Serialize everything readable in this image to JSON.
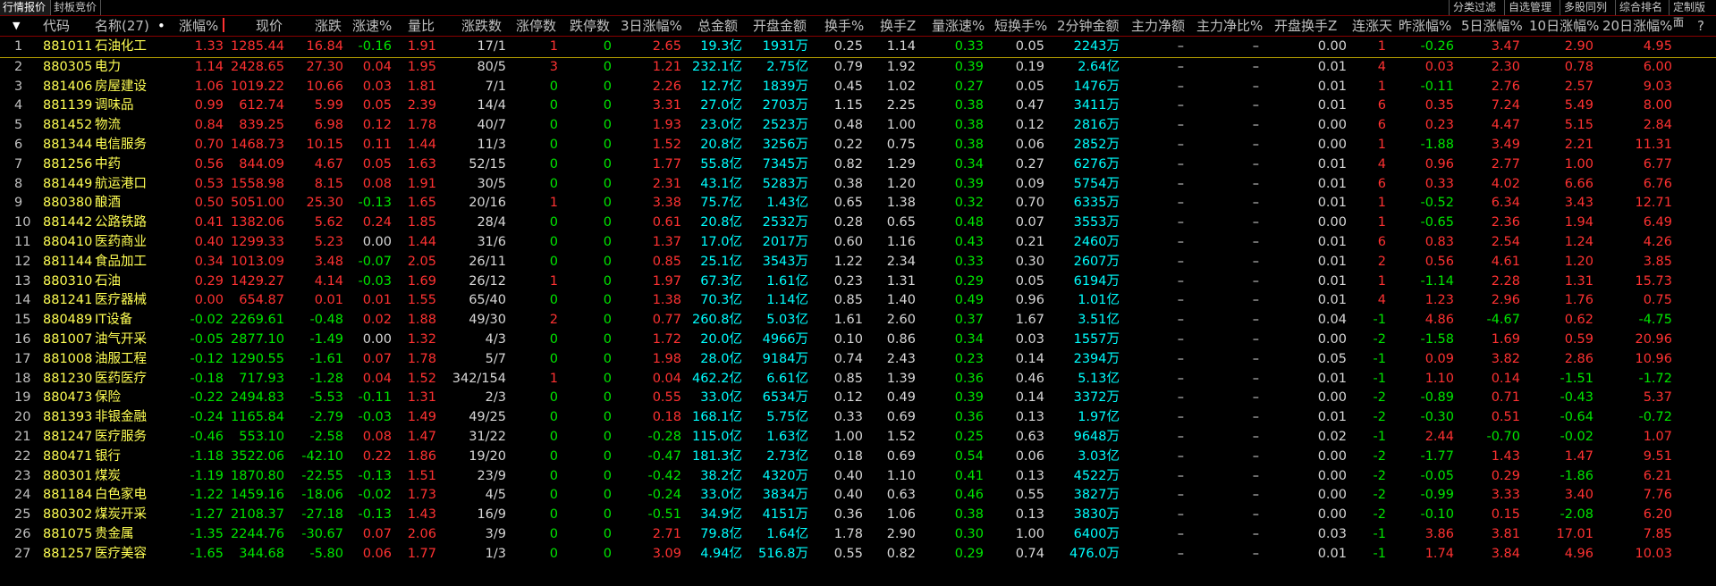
{
  "tabs": {
    "quotes": "行情报价",
    "seal": "封板竞价"
  },
  "right_tabs": {
    "filter": "分类过滤",
    "custom": "自选管理",
    "multi": "多股同列",
    "rank": "综合排名",
    "layout": "定制版面"
  },
  "sort_glyph": "▼",
  "name_suffix": "•",
  "question_mark": "?",
  "header": {
    "code": "代码",
    "name": "名称(27)",
    "pct": "涨幅%",
    "price": "现价",
    "change": "涨跌",
    "speed": "涨速%",
    "ratio": "量比",
    "updown": "涨跌数",
    "limitup": "涨停数",
    "limitdown": "跌停数",
    "pct3d": "3日涨幅%",
    "amount": "总金额",
    "openamt": "开盘金额",
    "turnover": "换手%",
    "turnoverz": "换手Z",
    "volspeed": "量涨速%",
    "shortturn": "短换手%",
    "amt2m": "2分钟金额",
    "mainnet": "主力净额",
    "mainpct": "主力净比%",
    "openturnz": "开盘换手Z",
    "streak": "连涨天",
    "yestpct": "昨涨幅%",
    "pct5d": "5日涨幅%",
    "pct10d": "10日涨幅%",
    "pct20d": "20日涨幅%"
  },
  "rows": [
    {
      "idx": "1",
      "code": "881011",
      "name": "石油化工",
      "pct": "1.33",
      "price": "1285.44",
      "change": "16.84",
      "speed": "-0.16",
      "ratio": "1.91",
      "updown": "17/1",
      "limitup": "1",
      "limitdown": "0",
      "pct3d": "2.65",
      "amount": "19.3亿",
      "openamt": "1931万",
      "turnover": "0.25",
      "turnoverz": "1.14",
      "volspeed": "0.33",
      "shortturn": "0.05",
      "amt2m": "2243万",
      "mainnet": "–",
      "mainpct": "–",
      "openturnz": "0.00",
      "streak": "1",
      "yestpct": "-0.26",
      "pct5d": "3.47",
      "pct10d": "2.90",
      "pct20d": "4.95"
    },
    {
      "idx": "2",
      "code": "880305",
      "name": "电力",
      "pct": "1.14",
      "price": "2428.65",
      "change": "27.30",
      "speed": "0.04",
      "ratio": "1.95",
      "updown": "80/5",
      "limitup": "3",
      "limitdown": "0",
      "pct3d": "1.21",
      "amount": "232.1亿",
      "openamt": "2.75亿",
      "turnover": "0.79",
      "turnoverz": "1.92",
      "volspeed": "0.39",
      "shortturn": "0.19",
      "amt2m": "2.64亿",
      "mainnet": "–",
      "mainpct": "–",
      "openturnz": "0.01",
      "streak": "4",
      "yestpct": "0.03",
      "pct5d": "2.30",
      "pct10d": "0.78",
      "pct20d": "6.00"
    },
    {
      "idx": "3",
      "code": "881406",
      "name": "房屋建设",
      "pct": "1.06",
      "price": "1019.22",
      "change": "10.66",
      "speed": "0.03",
      "ratio": "1.81",
      "updown": "7/1",
      "limitup": "0",
      "limitdown": "0",
      "pct3d": "2.26",
      "amount": "12.7亿",
      "openamt": "1839万",
      "turnover": "0.45",
      "turnoverz": "1.02",
      "volspeed": "0.27",
      "shortturn": "0.05",
      "amt2m": "1476万",
      "mainnet": "–",
      "mainpct": "–",
      "openturnz": "0.01",
      "streak": "1",
      "yestpct": "-0.11",
      "pct5d": "2.76",
      "pct10d": "2.57",
      "pct20d": "9.03"
    },
    {
      "idx": "4",
      "code": "881139",
      "name": "调味品",
      "pct": "0.99",
      "price": "612.74",
      "change": "5.99",
      "speed": "0.05",
      "ratio": "2.39",
      "updown": "14/4",
      "limitup": "0",
      "limitdown": "0",
      "pct3d": "3.31",
      "amount": "27.0亿",
      "openamt": "2703万",
      "turnover": "1.15",
      "turnoverz": "2.25",
      "volspeed": "0.38",
      "shortturn": "0.47",
      "amt2m": "3411万",
      "mainnet": "–",
      "mainpct": "–",
      "openturnz": "0.01",
      "streak": "6",
      "yestpct": "0.35",
      "pct5d": "7.24",
      "pct10d": "5.49",
      "pct20d": "8.00"
    },
    {
      "idx": "5",
      "code": "881452",
      "name": "物流",
      "pct": "0.84",
      "price": "839.25",
      "change": "6.98",
      "speed": "0.12",
      "ratio": "1.78",
      "updown": "40/7",
      "limitup": "0",
      "limitdown": "0",
      "pct3d": "1.93",
      "amount": "23.0亿",
      "openamt": "2523万",
      "turnover": "0.48",
      "turnoverz": "1.00",
      "volspeed": "0.38",
      "shortturn": "0.12",
      "amt2m": "2816万",
      "mainnet": "–",
      "mainpct": "–",
      "openturnz": "0.00",
      "streak": "6",
      "yestpct": "0.23",
      "pct5d": "4.47",
      "pct10d": "5.15",
      "pct20d": "2.84"
    },
    {
      "idx": "6",
      "code": "881344",
      "name": "电信服务",
      "pct": "0.70",
      "price": "1468.73",
      "change": "10.15",
      "speed": "0.11",
      "ratio": "1.44",
      "updown": "11/3",
      "limitup": "0",
      "limitdown": "0",
      "pct3d": "1.52",
      "amount": "20.8亿",
      "openamt": "3256万",
      "turnover": "0.22",
      "turnoverz": "0.75",
      "volspeed": "0.38",
      "shortturn": "0.06",
      "amt2m": "2852万",
      "mainnet": "–",
      "mainpct": "–",
      "openturnz": "0.00",
      "streak": "1",
      "yestpct": "-1.88",
      "pct5d": "3.49",
      "pct10d": "2.21",
      "pct20d": "11.31"
    },
    {
      "idx": "7",
      "code": "881256",
      "name": "中药",
      "pct": "0.56",
      "price": "844.09",
      "change": "4.67",
      "speed": "0.05",
      "ratio": "1.63",
      "updown": "52/15",
      "limitup": "0",
      "limitdown": "0",
      "pct3d": "1.77",
      "amount": "55.8亿",
      "openamt": "7345万",
      "turnover": "0.82",
      "turnoverz": "1.29",
      "volspeed": "0.34",
      "shortturn": "0.27",
      "amt2m": "6276万",
      "mainnet": "–",
      "mainpct": "–",
      "openturnz": "0.01",
      "streak": "4",
      "yestpct": "0.96",
      "pct5d": "2.77",
      "pct10d": "1.00",
      "pct20d": "6.77"
    },
    {
      "idx": "8",
      "code": "881449",
      "name": "航运港口",
      "pct": "0.53",
      "price": "1558.98",
      "change": "8.15",
      "speed": "0.08",
      "ratio": "1.91",
      "updown": "30/5",
      "limitup": "0",
      "limitdown": "0",
      "pct3d": "2.31",
      "amount": "43.1亿",
      "openamt": "5283万",
      "turnover": "0.38",
      "turnoverz": "1.20",
      "volspeed": "0.39",
      "shortturn": "0.09",
      "amt2m": "5754万",
      "mainnet": "–",
      "mainpct": "–",
      "openturnz": "0.01",
      "streak": "6",
      "yestpct": "0.33",
      "pct5d": "4.02",
      "pct10d": "6.66",
      "pct20d": "6.76"
    },
    {
      "idx": "9",
      "code": "880380",
      "name": "酿酒",
      "pct": "0.50",
      "price": "5051.00",
      "change": "25.30",
      "speed": "-0.13",
      "ratio": "1.65",
      "updown": "20/16",
      "limitup": "1",
      "limitdown": "0",
      "pct3d": "3.38",
      "amount": "75.7亿",
      "openamt": "1.43亿",
      "turnover": "0.65",
      "turnoverz": "1.38",
      "volspeed": "0.32",
      "shortturn": "0.70",
      "amt2m": "6335万",
      "mainnet": "–",
      "mainpct": "–",
      "openturnz": "0.01",
      "streak": "1",
      "yestpct": "-0.52",
      "pct5d": "6.34",
      "pct10d": "3.43",
      "pct20d": "12.71"
    },
    {
      "idx": "10",
      "code": "881442",
      "name": "公路铁路",
      "pct": "0.41",
      "price": "1382.06",
      "change": "5.62",
      "speed": "0.24",
      "ratio": "1.85",
      "updown": "28/4",
      "limitup": "0",
      "limitdown": "0",
      "pct3d": "0.61",
      "amount": "20.8亿",
      "openamt": "2532万",
      "turnover": "0.28",
      "turnoverz": "0.65",
      "volspeed": "0.48",
      "shortturn": "0.07",
      "amt2m": "3553万",
      "mainnet": "–",
      "mainpct": "–",
      "openturnz": "0.00",
      "streak": "1",
      "yestpct": "-0.65",
      "pct5d": "2.36",
      "pct10d": "1.94",
      "pct20d": "6.49"
    },
    {
      "idx": "11",
      "code": "880410",
      "name": "医药商业",
      "pct": "0.40",
      "price": "1299.33",
      "change": "5.23",
      "speed": "0.00",
      "ratio": "1.44",
      "updown": "31/6",
      "limitup": "0",
      "limitdown": "0",
      "pct3d": "1.37",
      "amount": "17.0亿",
      "openamt": "2017万",
      "turnover": "0.60",
      "turnoverz": "1.16",
      "volspeed": "0.43",
      "shortturn": "0.21",
      "amt2m": "2460万",
      "mainnet": "–",
      "mainpct": "–",
      "openturnz": "0.01",
      "streak": "6",
      "yestpct": "0.83",
      "pct5d": "2.54",
      "pct10d": "1.24",
      "pct20d": "4.26"
    },
    {
      "idx": "12",
      "code": "881144",
      "name": "食品加工",
      "pct": "0.34",
      "price": "1013.09",
      "change": "3.48",
      "speed": "-0.07",
      "ratio": "2.05",
      "updown": "26/11",
      "limitup": "0",
      "limitdown": "0",
      "pct3d": "0.85",
      "amount": "25.1亿",
      "openamt": "3543万",
      "turnover": "1.22",
      "turnoverz": "2.34",
      "volspeed": "0.33",
      "shortturn": "0.30",
      "amt2m": "2607万",
      "mainnet": "–",
      "mainpct": "–",
      "openturnz": "0.01",
      "streak": "2",
      "yestpct": "0.56",
      "pct5d": "4.61",
      "pct10d": "1.20",
      "pct20d": "3.85"
    },
    {
      "idx": "13",
      "code": "880310",
      "name": "石油",
      "pct": "0.29",
      "price": "1429.27",
      "change": "4.14",
      "speed": "-0.03",
      "ratio": "1.69",
      "updown": "26/12",
      "limitup": "1",
      "limitdown": "0",
      "pct3d": "1.97",
      "amount": "67.3亿",
      "openamt": "1.61亿",
      "turnover": "0.23",
      "turnoverz": "1.31",
      "volspeed": "0.29",
      "shortturn": "0.05",
      "amt2m": "6194万",
      "mainnet": "–",
      "mainpct": "–",
      "openturnz": "0.01",
      "streak": "1",
      "yestpct": "-1.14",
      "pct5d": "2.28",
      "pct10d": "1.31",
      "pct20d": "15.73"
    },
    {
      "idx": "14",
      "code": "881241",
      "name": "医疗器械",
      "pct": "0.00",
      "price": "654.87",
      "change": "0.01",
      "speed": "0.01",
      "ratio": "1.55",
      "updown": "65/40",
      "limitup": "0",
      "limitdown": "0",
      "pct3d": "1.38",
      "amount": "70.3亿",
      "openamt": "1.14亿",
      "turnover": "0.85",
      "turnoverz": "1.40",
      "volspeed": "0.49",
      "shortturn": "0.96",
      "amt2m": "1.01亿",
      "mainnet": "–",
      "mainpct": "–",
      "openturnz": "0.01",
      "streak": "4",
      "yestpct": "1.23",
      "pct5d": "2.96",
      "pct10d": "1.76",
      "pct20d": "0.75"
    },
    {
      "idx": "15",
      "code": "880489",
      "name": "IT设备",
      "pct": "-0.02",
      "price": "2269.61",
      "change": "-0.48",
      "speed": "0.02",
      "ratio": "1.88",
      "updown": "49/30",
      "limitup": "2",
      "limitdown": "0",
      "pct3d": "0.77",
      "amount": "260.8亿",
      "openamt": "5.03亿",
      "turnover": "1.61",
      "turnoverz": "2.60",
      "volspeed": "0.37",
      "shortturn": "1.67",
      "amt2m": "3.51亿",
      "mainnet": "–",
      "mainpct": "–",
      "openturnz": "0.04",
      "streak": "-1",
      "yestpct": "4.86",
      "pct5d": "-4.67",
      "pct10d": "0.62",
      "pct20d": "-4.75"
    },
    {
      "idx": "16",
      "code": "881007",
      "name": "油气开采",
      "pct": "-0.05",
      "price": "2877.10",
      "change": "-1.49",
      "speed": "0.00",
      "ratio": "1.32",
      "updown": "4/3",
      "limitup": "0",
      "limitdown": "0",
      "pct3d": "1.72",
      "amount": "20.0亿",
      "openamt": "4966万",
      "turnover": "0.10",
      "turnoverz": "0.86",
      "volspeed": "0.34",
      "shortturn": "0.03",
      "amt2m": "1557万",
      "mainnet": "–",
      "mainpct": "–",
      "openturnz": "0.00",
      "streak": "-2",
      "yestpct": "-1.58",
      "pct5d": "1.69",
      "pct10d": "0.59",
      "pct20d": "20.96"
    },
    {
      "idx": "17",
      "code": "881008",
      "name": "油服工程",
      "pct": "-0.12",
      "price": "1290.55",
      "change": "-1.61",
      "speed": "0.07",
      "ratio": "1.78",
      "updown": "5/7",
      "limitup": "0",
      "limitdown": "0",
      "pct3d": "1.98",
      "amount": "28.0亿",
      "openamt": "9184万",
      "turnover": "0.74",
      "turnoverz": "2.43",
      "volspeed": "0.23",
      "shortturn": "0.14",
      "amt2m": "2394万",
      "mainnet": "–",
      "mainpct": "–",
      "openturnz": "0.05",
      "streak": "-1",
      "yestpct": "0.09",
      "pct5d": "3.82",
      "pct10d": "2.86",
      "pct20d": "10.96"
    },
    {
      "idx": "18",
      "code": "881230",
      "name": "医药医疗",
      "pct": "-0.18",
      "price": "717.93",
      "change": "-1.28",
      "speed": "0.04",
      "ratio": "1.52",
      "updown": "342/154",
      "limitup": "1",
      "limitdown": "0",
      "pct3d": "0.04",
      "amount": "462.2亿",
      "openamt": "6.61亿",
      "turnover": "0.85",
      "turnoverz": "1.39",
      "volspeed": "0.36",
      "shortturn": "0.46",
      "amt2m": "5.13亿",
      "mainnet": "–",
      "mainpct": "–",
      "openturnz": "0.01",
      "streak": "-1",
      "yestpct": "1.10",
      "pct5d": "0.14",
      "pct10d": "-1.51",
      "pct20d": "-1.72"
    },
    {
      "idx": "19",
      "code": "880473",
      "name": "保险",
      "pct": "-0.22",
      "price": "2494.83",
      "change": "-5.53",
      "speed": "-0.11",
      "ratio": "1.31",
      "updown": "2/3",
      "limitup": "0",
      "limitdown": "0",
      "pct3d": "0.55",
      "amount": "33.0亿",
      "openamt": "6534万",
      "turnover": "0.12",
      "turnoverz": "0.49",
      "volspeed": "0.39",
      "shortturn": "0.14",
      "amt2m": "3372万",
      "mainnet": "–",
      "mainpct": "–",
      "openturnz": "0.00",
      "streak": "-2",
      "yestpct": "-0.89",
      "pct5d": "0.71",
      "pct10d": "-0.43",
      "pct20d": "5.37"
    },
    {
      "idx": "20",
      "code": "881393",
      "name": "非银金融",
      "pct": "-0.24",
      "price": "1165.84",
      "change": "-2.79",
      "speed": "-0.03",
      "ratio": "1.49",
      "updown": "49/25",
      "limitup": "0",
      "limitdown": "0",
      "pct3d": "0.18",
      "amount": "168.1亿",
      "openamt": "5.75亿",
      "turnover": "0.33",
      "turnoverz": "0.69",
      "volspeed": "0.36",
      "shortturn": "0.13",
      "amt2m": "1.97亿",
      "mainnet": "–",
      "mainpct": "–",
      "openturnz": "0.01",
      "streak": "-2",
      "yestpct": "-0.30",
      "pct5d": "0.51",
      "pct10d": "-0.64",
      "pct20d": "-0.72"
    },
    {
      "idx": "21",
      "code": "881247",
      "name": "医疗服务",
      "pct": "-0.46",
      "price": "553.10",
      "change": "-2.58",
      "speed": "0.08",
      "ratio": "1.47",
      "updown": "31/22",
      "limitup": "0",
      "limitdown": "0",
      "pct3d": "-0.28",
      "amount": "115.0亿",
      "openamt": "1.63亿",
      "turnover": "1.00",
      "turnoverz": "1.52",
      "volspeed": "0.25",
      "shortturn": "0.63",
      "amt2m": "9648万",
      "mainnet": "–",
      "mainpct": "–",
      "openturnz": "0.02",
      "streak": "-1",
      "yestpct": "2.44",
      "pct5d": "-0.70",
      "pct10d": "-0.02",
      "pct20d": "1.07"
    },
    {
      "idx": "22",
      "code": "880471",
      "name": "银行",
      "pct": "-1.18",
      "price": "3522.06",
      "change": "-42.10",
      "speed": "0.22",
      "ratio": "1.86",
      "updown": "19/20",
      "limitup": "0",
      "limitdown": "0",
      "pct3d": "-0.47",
      "amount": "181.3亿",
      "openamt": "2.73亿",
      "turnover": "0.18",
      "turnoverz": "0.69",
      "volspeed": "0.54",
      "shortturn": "0.06",
      "amt2m": "3.03亿",
      "mainnet": "–",
      "mainpct": "–",
      "openturnz": "0.00",
      "streak": "-2",
      "yestpct": "-1.77",
      "pct5d": "1.43",
      "pct10d": "1.47",
      "pct20d": "9.51"
    },
    {
      "idx": "23",
      "code": "880301",
      "name": "煤炭",
      "pct": "-1.19",
      "price": "1870.80",
      "change": "-22.55",
      "speed": "-0.13",
      "ratio": "1.51",
      "updown": "23/9",
      "limitup": "0",
      "limitdown": "0",
      "pct3d": "-0.42",
      "amount": "38.2亿",
      "openamt": "4320万",
      "turnover": "0.40",
      "turnoverz": "1.10",
      "volspeed": "0.41",
      "shortturn": "0.13",
      "amt2m": "4522万",
      "mainnet": "–",
      "mainpct": "–",
      "openturnz": "0.00",
      "streak": "-2",
      "yestpct": "-0.05",
      "pct5d": "0.29",
      "pct10d": "-1.86",
      "pct20d": "6.21"
    },
    {
      "idx": "24",
      "code": "881184",
      "name": "白色家电",
      "pct": "-1.22",
      "price": "1459.16",
      "change": "-18.06",
      "speed": "-0.02",
      "ratio": "1.73",
      "updown": "4/5",
      "limitup": "0",
      "limitdown": "0",
      "pct3d": "-0.24",
      "amount": "33.0亿",
      "openamt": "3834万",
      "turnover": "0.40",
      "turnoverz": "0.63",
      "volspeed": "0.46",
      "shortturn": "0.55",
      "amt2m": "3827万",
      "mainnet": "–",
      "mainpct": "–",
      "openturnz": "0.00",
      "streak": "-2",
      "yestpct": "-0.99",
      "pct5d": "3.33",
      "pct10d": "3.40",
      "pct20d": "7.76"
    },
    {
      "idx": "25",
      "code": "880302",
      "name": "煤炭开采",
      "pct": "-1.27",
      "price": "2108.37",
      "change": "-27.18",
      "speed": "-0.13",
      "ratio": "1.43",
      "updown": "16/9",
      "limitup": "0",
      "limitdown": "0",
      "pct3d": "-0.51",
      "amount": "34.9亿",
      "openamt": "4151万",
      "turnover": "0.36",
      "turnoverz": "1.06",
      "volspeed": "0.38",
      "shortturn": "0.13",
      "amt2m": "3830万",
      "mainnet": "–",
      "mainpct": "–",
      "openturnz": "0.00",
      "streak": "-2",
      "yestpct": "-0.10",
      "pct5d": "0.15",
      "pct10d": "-2.08",
      "pct20d": "6.20"
    },
    {
      "idx": "26",
      "code": "881075",
      "name": "贵金属",
      "pct": "-1.35",
      "price": "2244.76",
      "change": "-30.67",
      "speed": "0.07",
      "ratio": "2.06",
      "updown": "3/9",
      "limitup": "0",
      "limitdown": "0",
      "pct3d": "2.71",
      "amount": "79.8亿",
      "openamt": "1.64亿",
      "turnover": "1.78",
      "turnoverz": "2.90",
      "volspeed": "0.30",
      "shortturn": "1.00",
      "amt2m": "6400万",
      "mainnet": "–",
      "mainpct": "–",
      "openturnz": "0.03",
      "streak": "-1",
      "yestpct": "3.86",
      "pct5d": "3.81",
      "pct10d": "17.01",
      "pct20d": "7.85"
    },
    {
      "idx": "27",
      "code": "881257",
      "name": "医疗美容",
      "pct": "-1.65",
      "price": "344.68",
      "change": "-5.80",
      "speed": "0.06",
      "ratio": "1.77",
      "updown": "1/3",
      "limitup": "0",
      "limitdown": "0",
      "pct3d": "3.09",
      "amount": "4.94亿",
      "openamt": "516.8万",
      "turnover": "0.55",
      "turnoverz": "0.82",
      "volspeed": "0.29",
      "shortturn": "0.74",
      "amt2m": "476.0万",
      "mainnet": "–",
      "mainpct": "–",
      "openturnz": "0.01",
      "streak": "-1",
      "yestpct": "1.74",
      "pct5d": "3.84",
      "pct10d": "4.96",
      "pct20d": "10.03"
    }
  ]
}
